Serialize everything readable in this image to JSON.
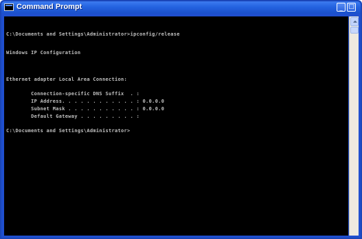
{
  "window": {
    "title": "Command Prompt",
    "controls": {
      "minimize": "_",
      "maximize": "□"
    }
  },
  "console": {
    "lines": [
      "C:\\Documents and Settings\\Administrator>ipconfig/release",
      "",
      "Windows IP Configuration",
      "",
      "",
      "Ethernet adapter Local Area Connection:",
      "",
      "        Connection-specific DNS Suffix  . :",
      "        IP Address. . . . . . . . . . . . : 0.0.0.0",
      "        Subnet Mask . . . . . . . . . . . : 0.0.0.0",
      "        Default Gateway . . . . . . . . . :",
      "",
      "C:\\Documents and Settings\\Administrator>"
    ]
  },
  "colors": {
    "titlebar": "#2463e0",
    "console_bg": "#000000",
    "console_text": "#c0c0c0"
  },
  "icons": {
    "app": "cmd-icon",
    "minimize": "minimize-icon",
    "maximize": "maximize-icon",
    "scroll_up": "chevron-up-icon"
  }
}
